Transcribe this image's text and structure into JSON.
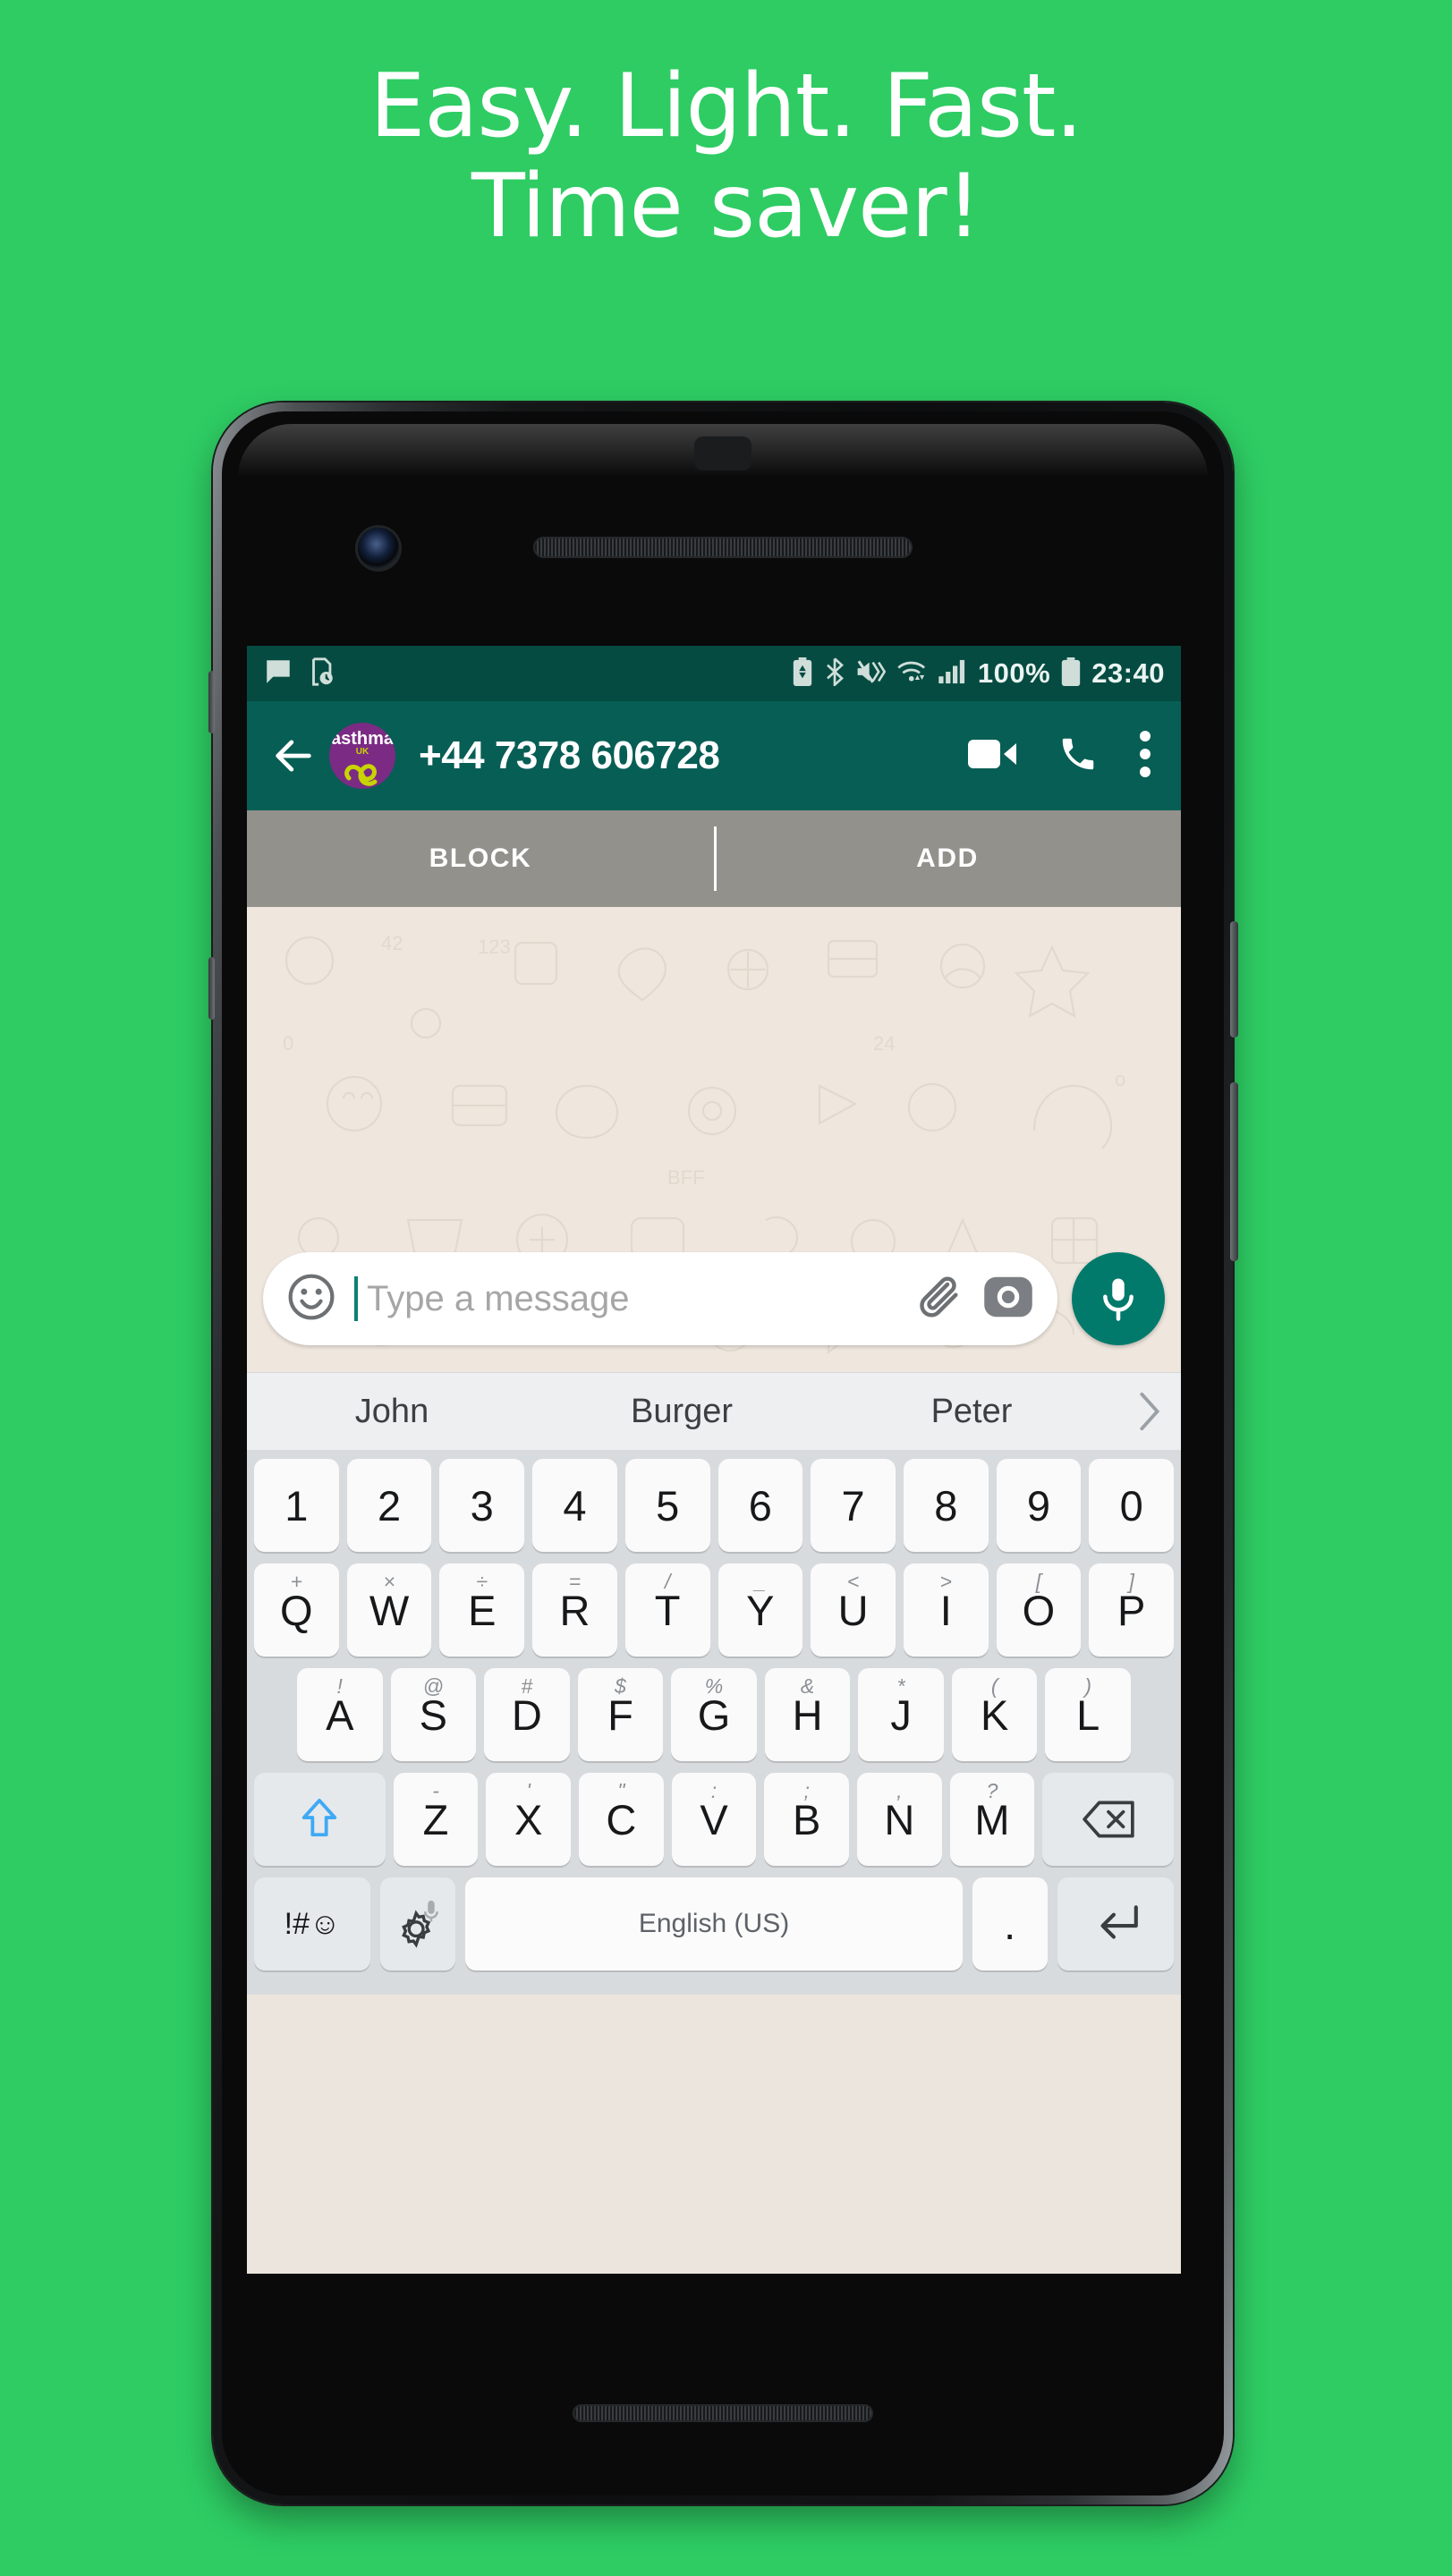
{
  "promo": {
    "line1": "Easy. Light. Fast.",
    "line2": "Time saver!",
    "background_color": "#2ECC63",
    "text_color": "#FFFFFF"
  },
  "statusbar": {
    "background_color": "#054B41",
    "left_icons": [
      "message-icon",
      "screenshot-clock-icon"
    ],
    "right_icons": [
      "battery-saver-icon",
      "bluetooth-icon",
      "mute-vibrate-icon",
      "wifi-icon",
      "signal-bars-icon",
      "battery-icon"
    ],
    "battery_label": "100%",
    "clock": "23:40"
  },
  "appbar": {
    "background_color": "#075E54",
    "back_icon": "back-arrow-icon",
    "avatar": {
      "name": "asthma",
      "sub": "UK",
      "background_color": "#7B2B84",
      "accent_color": "#C8D400"
    },
    "contact_name": "+44 7378 606728",
    "icons": [
      "video-call-icon",
      "voice-call-icon",
      "overflow-menu-icon"
    ]
  },
  "unknown_contact_bar": {
    "block_label": "BLOCK",
    "add_label": "ADD"
  },
  "composer": {
    "emoji_icon": "emoji-smiley-icon",
    "placeholder": "Type a message",
    "attach_icon": "paperclip-icon",
    "camera_icon": "camera-icon",
    "mic_icon": "microphone-icon",
    "mic_button_color": "#017A6B"
  },
  "suggestions": {
    "items": [
      "John",
      "Burger",
      "Peter"
    ],
    "expand_icon": "chevron-right-icon"
  },
  "keyboard": {
    "language_label": "English (US)",
    "rows": [
      {
        "name": "numbers",
        "keys": [
          {
            "main": "1"
          },
          {
            "main": "2"
          },
          {
            "main": "3"
          },
          {
            "main": "4"
          },
          {
            "main": "5"
          },
          {
            "main": "6"
          },
          {
            "main": "7"
          },
          {
            "main": "8"
          },
          {
            "main": "9"
          },
          {
            "main": "0"
          }
        ]
      },
      {
        "name": "qwerty",
        "keys": [
          {
            "main": "Q",
            "sup": "+"
          },
          {
            "main": "W",
            "sup": "×"
          },
          {
            "main": "E",
            "sup": "÷"
          },
          {
            "main": "R",
            "sup": "="
          },
          {
            "main": "T",
            "sup": "/"
          },
          {
            "main": "Y",
            "sup": "_"
          },
          {
            "main": "U",
            "sup": "<"
          },
          {
            "main": "I",
            "sup": ">"
          },
          {
            "main": "O",
            "sup": "["
          },
          {
            "main": "P",
            "sup": "]"
          }
        ]
      },
      {
        "name": "asdf",
        "keys": [
          {
            "main": "A",
            "sup": "!"
          },
          {
            "main": "S",
            "sup": "@"
          },
          {
            "main": "D",
            "sup": "#"
          },
          {
            "main": "F",
            "sup": "$"
          },
          {
            "main": "G",
            "sup": "%"
          },
          {
            "main": "H",
            "sup": "&"
          },
          {
            "main": "J",
            "sup": "*"
          },
          {
            "main": "K",
            "sup": "("
          },
          {
            "main": "L",
            "sup": ")"
          }
        ]
      },
      {
        "name": "zxcv",
        "keys": [
          {
            "main": "Z",
            "sup": "-"
          },
          {
            "main": "X",
            "sup": "'"
          },
          {
            "main": "C",
            "sup": "\""
          },
          {
            "main": "V",
            "sup": ":"
          },
          {
            "main": "B",
            "sup": ";"
          },
          {
            "main": "N",
            "sup": ","
          },
          {
            "main": "M",
            "sup": "?"
          }
        ],
        "shift_icon": "shift-arrow-icon",
        "backspace_icon": "backspace-icon"
      },
      {
        "name": "bottom",
        "symbols_label": "!#☺",
        "settings_icon": "gear-mic-icon",
        "period": ".",
        "enter_icon": "enter-return-icon"
      }
    ]
  }
}
